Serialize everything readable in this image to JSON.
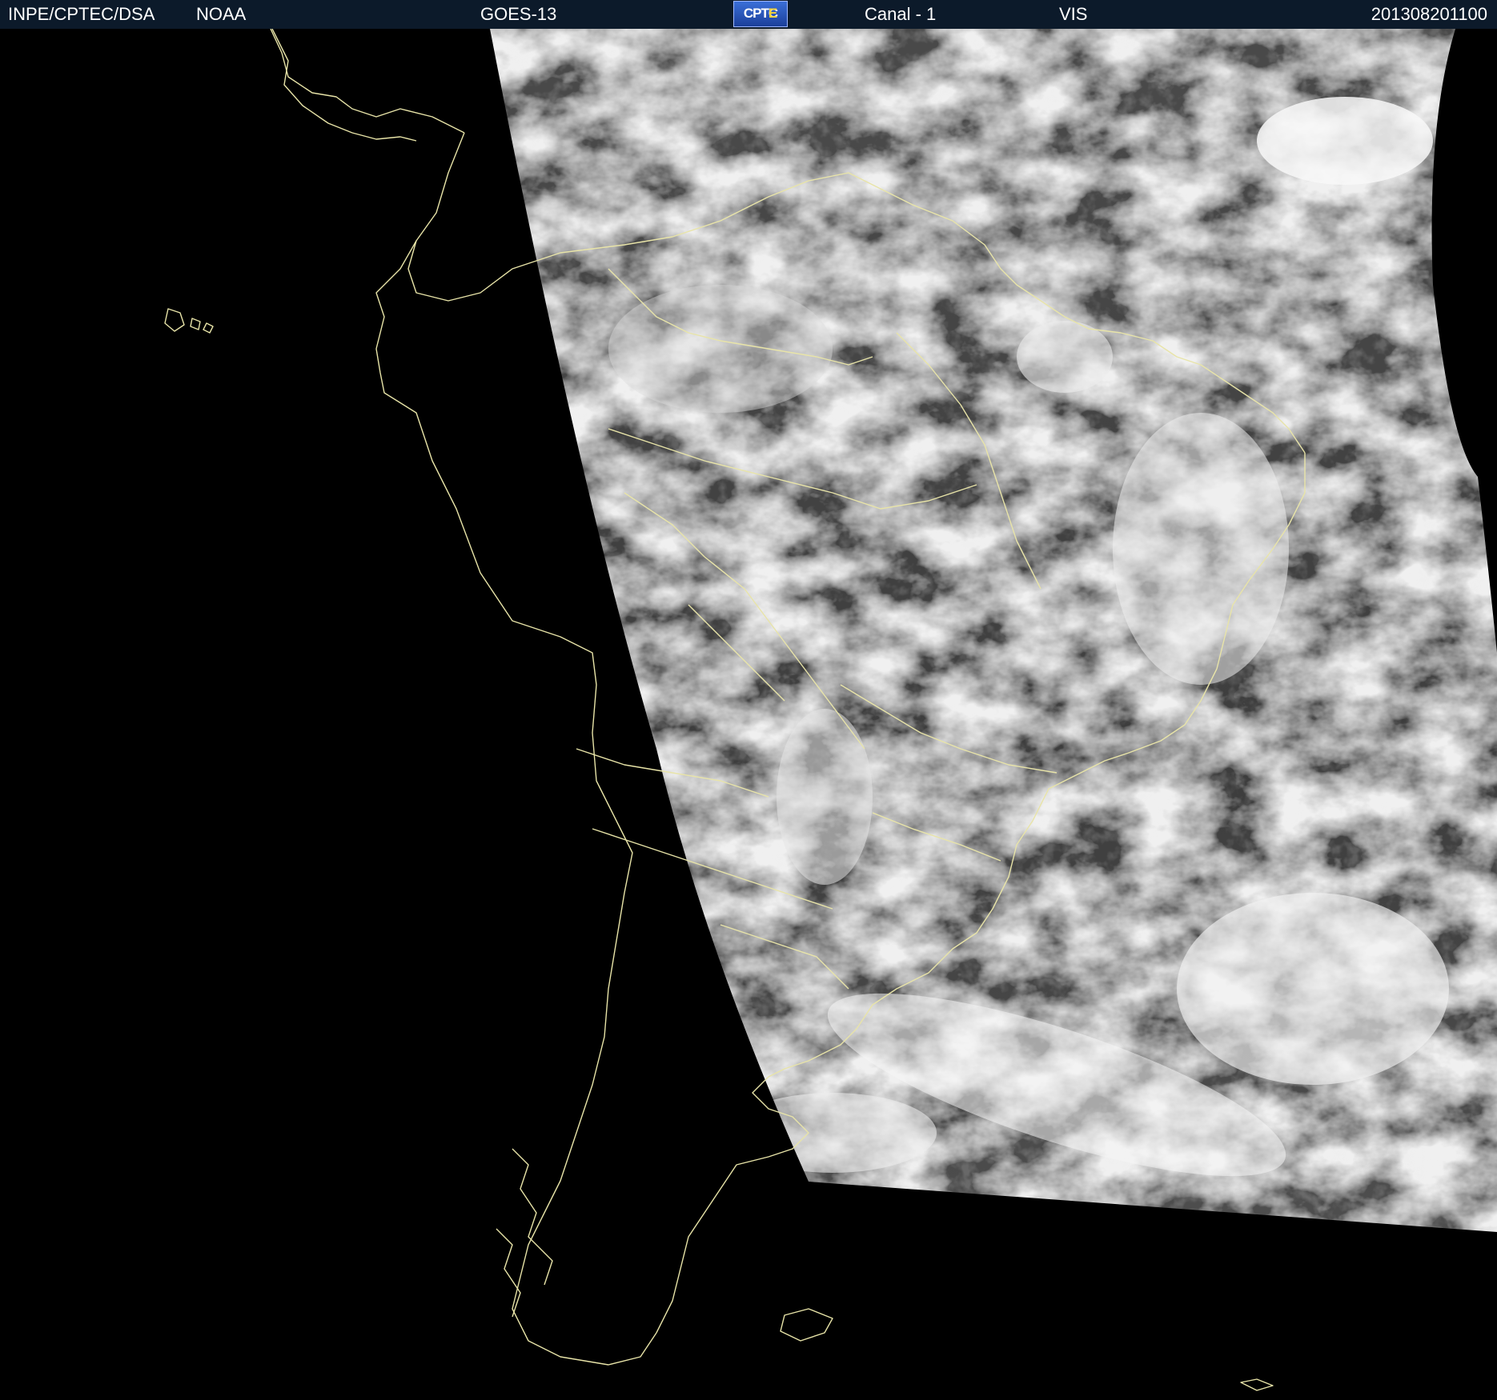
{
  "header": {
    "source": "INPE/CPTEC/DSA",
    "agency": "NOAA",
    "satellite": "GOES-13",
    "logo_text": "CPTEC",
    "channel": "Canal - 1",
    "band": "VIS",
    "timestamp": "201308201100"
  },
  "colors": {
    "header_bg": "#0c1a2a",
    "background": "#000000",
    "coastline": "#e8e4a8",
    "cloud_light": "#f4f4f4",
    "cloud_dark": "#3e3e3e"
  }
}
